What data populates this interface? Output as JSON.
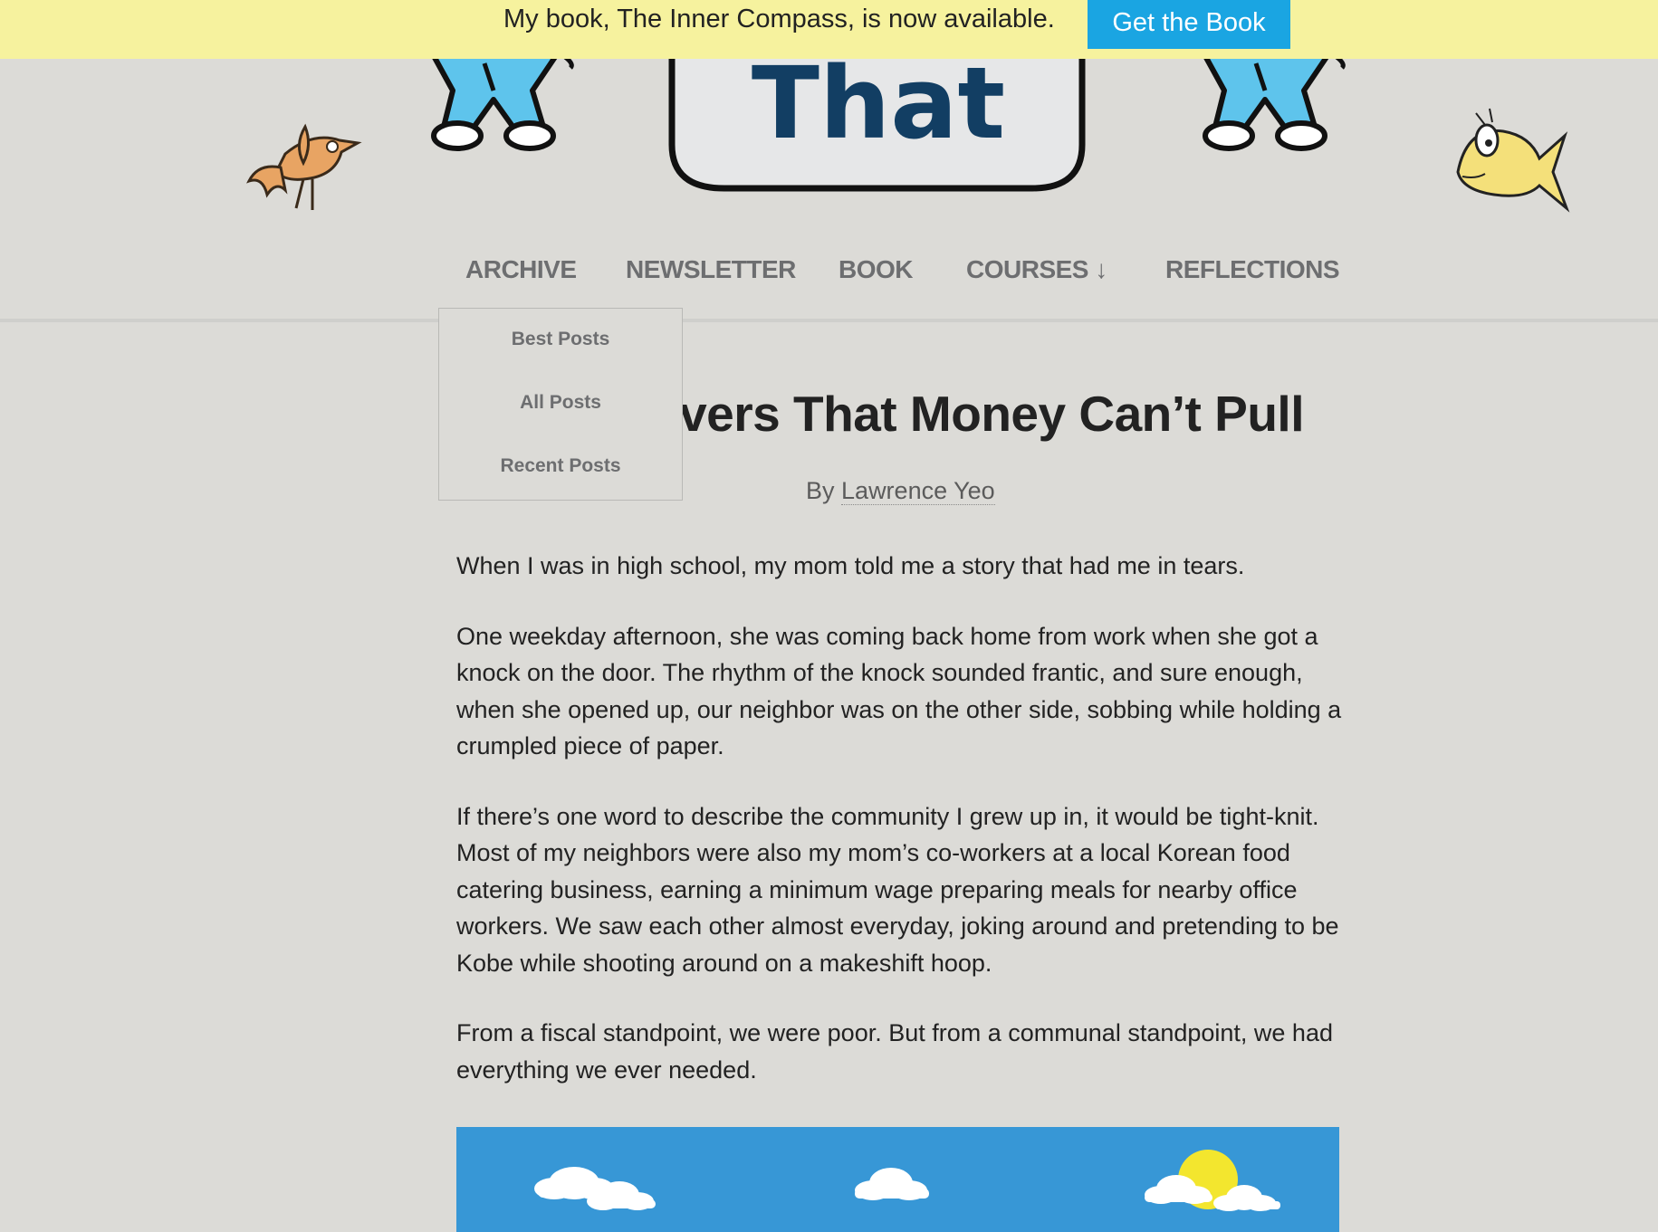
{
  "announcement": {
    "text": "My book, The Inner Compass, is now available.",
    "button_label": "Get the Book"
  },
  "header": {
    "logo_text": "That"
  },
  "nav": {
    "items": [
      {
        "label": "ARCHIVE"
      },
      {
        "label": "NEWSLETTER"
      },
      {
        "label": "BOOK"
      },
      {
        "label": "COURSES ↓"
      },
      {
        "label": "REFLECTIONS"
      }
    ],
    "dropdown": [
      {
        "label": "Best Posts"
      },
      {
        "label": "All Posts"
      },
      {
        "label": "Recent Posts"
      }
    ]
  },
  "article": {
    "title_visible": "vers That Money Can’t Pull",
    "byline_prefix": "By",
    "author": "Lawrence Yeo",
    "paragraphs": [
      "When I was in high school, my mom told me a story that had me in tears.",
      "One weekday afternoon, she was coming back home from work when she got a knock on the door. The rhythm of the knock sounded frantic, and sure enough, when she opened up, our neighbor was on the other side, sobbing while holding a crumpled piece of paper.",
      "If there’s one word to describe the community I grew up in, it would be tight-knit. Most of my neighbors were also my mom’s co-workers at a local Korean food catering business, earning a minimum wage preparing meals for nearby office workers. We saw each other almost everyday, joking around and pretending to be Kobe while shooting around on a makeshift hoop.",
      "From a fiscal standpoint, we were poor. But from a communal standpoint, we had everything we ever needed."
    ]
  },
  "colors": {
    "banner": "#f6f29e",
    "button": "#1aa5e2",
    "background": "#dcdbd7",
    "nav_text": "#6d6e70",
    "sky": "#3797d6",
    "sun": "#f3e62e"
  }
}
